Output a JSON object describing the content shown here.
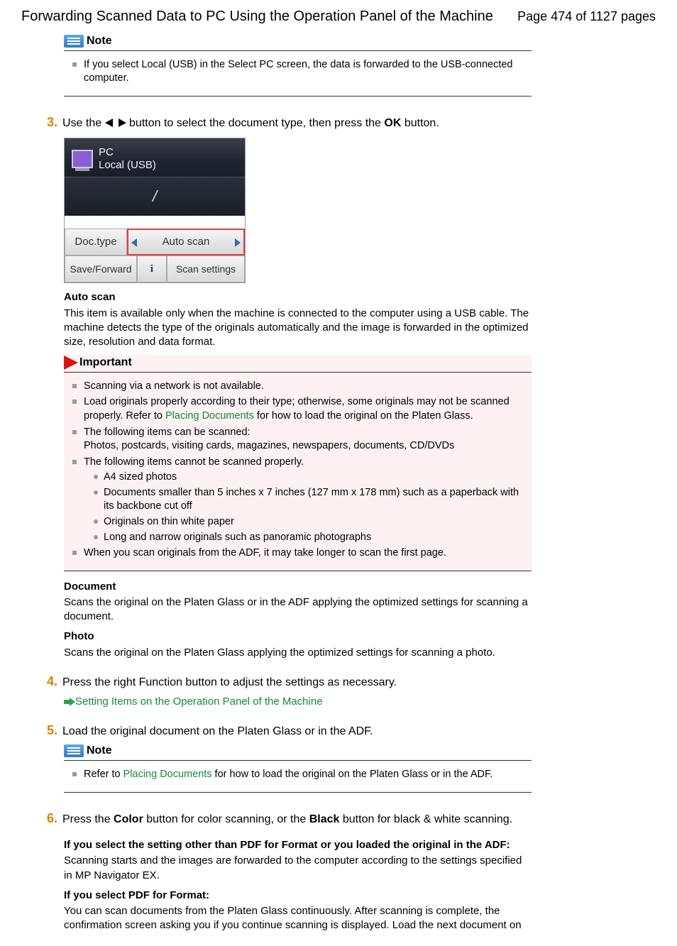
{
  "header": {
    "title": "Forwarding Scanned Data to PC Using the Operation Panel of the Machine",
    "page_label": "Page 474 of 1127 pages"
  },
  "note1": {
    "heading": "Note",
    "item1": "If you select Local (USB) in the Select PC screen, the data is forwarded to the USB-connected computer."
  },
  "step3": {
    "num": "3.",
    "pre": "Use the ",
    "mid": " button to select the document type, then press the ",
    "ok": "OK",
    "post": " button."
  },
  "screenshot": {
    "pc": "PC",
    "local": "Local (USB)",
    "slash": "/",
    "doctype": "Doc.type",
    "autoscan": "Auto scan",
    "save": "Save/Forward",
    "info": "i",
    "scansettings": "Scan settings"
  },
  "autoscan": {
    "heading": "Auto scan",
    "text": "This item is available only when the machine is connected to the computer using a USB cable. The machine detects the type of the originals automatically and the image is forwarded in the optimized size, resolution and data format."
  },
  "important": {
    "heading": "Important",
    "i1": "Scanning via a network is not available.",
    "i2a": "Load originals properly according to their type; otherwise, some originals may not be scanned properly. Refer to ",
    "i2link": "Placing Documents",
    "i2b": " for how to load the original on the Platen Glass.",
    "i3": "The following items can be scanned:",
    "i3b": "Photos, postcards, visiting cards, magazines, newspapers, documents, CD/DVDs",
    "i4": "The following items cannot be scanned properly.",
    "i4_1": "A4 sized photos",
    "i4_2": "Documents smaller than 5 inches x 7 inches (127 mm x 178 mm) such as a paperback with its backbone cut off",
    "i4_3": "Originals on thin white paper",
    "i4_4": "Long and narrow originals such as panoramic photographs",
    "i5": "When you scan originals from the ADF, it may take longer to scan the first page."
  },
  "document": {
    "heading": "Document",
    "text": "Scans the original on the Platen Glass or in the ADF applying the optimized settings for scanning a document."
  },
  "photo": {
    "heading": "Photo",
    "text": "Scans the original on the Platen Glass applying the optimized settings for scanning a photo."
  },
  "step4": {
    "num": "4.",
    "text": "Press the right Function button to adjust the settings as necessary.",
    "link": "Setting Items on the Operation Panel of the Machine"
  },
  "step5": {
    "num": "5.",
    "text": "Load the original document on the Platen Glass or in the ADF."
  },
  "note2": {
    "heading": "Note",
    "pre": "Refer to ",
    "link": "Placing Documents",
    "post": " for how to load the original on the Platen Glass or in the ADF."
  },
  "step6": {
    "num": "6.",
    "pre": "Press the ",
    "color": "Color",
    "mid": " button for color scanning, or the ",
    "black": "Black",
    "post": " button for black & white scanning."
  },
  "pdf1": {
    "heading": "If you select the setting other than PDF for Format or you loaded the original in the ADF:",
    "text": "Scanning starts and the images are forwarded to the computer according to the settings specified in MP Navigator EX."
  },
  "pdf2": {
    "heading": "If you select PDF for Format:",
    "text": "You can scan documents from the Platen Glass continuously. After scanning is complete, the confirmation screen asking you if you continue scanning is displayed. Load the next document on"
  }
}
